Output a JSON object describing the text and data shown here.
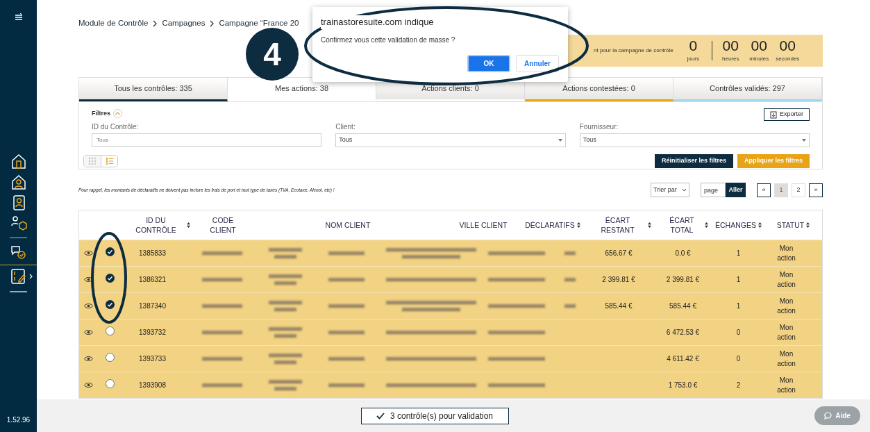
{
  "sidebar": {
    "version": "1.52.96"
  },
  "breadcrumb": [
    "Module de Contrôle",
    "Campagnes",
    "Campagne “France 20"
  ],
  "countdown": {
    "caption": "nt pour la campagne de contrôle",
    "units": [
      {
        "value": "0",
        "label": "jours"
      },
      {
        "value": "00",
        "label": "heures"
      },
      {
        "value": "00",
        "label": "minutes"
      },
      {
        "value": "00",
        "label": "secondes"
      }
    ]
  },
  "tabs": [
    {
      "label": "Tous les contrôles: 335",
      "selected": false,
      "color": "#0d2c40"
    },
    {
      "label": "Mes actions: 38",
      "selected": true
    },
    {
      "label": "Actions clients: 0",
      "selected": false
    },
    {
      "label": "Actions contestées: 0",
      "selected": false,
      "color": "#e8a317"
    },
    {
      "label": "Contrôles validés: 297",
      "selected": false,
      "color": "#9fd6f0"
    }
  ],
  "filters": {
    "title": "Filtres",
    "export": "Exporter",
    "fields": [
      {
        "kind": "text",
        "label": "ID du Contrôle:",
        "placeholder": "Tous"
      },
      {
        "kind": "select",
        "label": "Client:",
        "value": "Tous"
      },
      {
        "kind": "select",
        "label": "Fournisseur:",
        "value": "Tous"
      }
    ],
    "view_modes": [
      {
        "kind": "grid",
        "selected": false
      },
      {
        "kind": "list",
        "selected": true
      }
    ],
    "reset": "Réinitialiser les filtres",
    "apply": "Appliquer les filtres"
  },
  "note": "Pour rappel, les montants de déclaratifs ne doivent pas inclure les frais de port et tout type de taxes (TVA, Ecotaxe, Alcool, etc) !",
  "sort": {
    "label": "Trier par"
  },
  "goto": {
    "placeholder": "page",
    "button": "Aller"
  },
  "pagination": {
    "prev": "«",
    "pages": [
      {
        "label": "1",
        "selected": true
      },
      {
        "label": "2",
        "selected": false
      }
    ],
    "next": "»"
  },
  "table": {
    "columns": [
      {
        "label": "ID DU CONTRÔLE",
        "sortable": true
      },
      {
        "label": "CODE CLIENT",
        "sortable": false
      },
      {
        "label": "NOM CLIENT",
        "sortable": false
      },
      {
        "label": "VILLE CLIENT",
        "sortable": false
      },
      {
        "label": "DÉCLARATIFS",
        "sortable": true
      },
      {
        "label": "ÉCART RESTANT",
        "sortable": true
      },
      {
        "label": "ÉCART TOTAL",
        "sortable": true
      },
      {
        "label": "ÉCHANGES",
        "sortable": true
      },
      {
        "label": "STATUT",
        "sortable": true
      }
    ],
    "rows": [
      {
        "id": "1385833",
        "checked": true,
        "declaratifs_blurred": true,
        "nom_wraps": true,
        "ecart_restant": "656.67 €",
        "ecart_total": "0.0 €",
        "echanges": "1",
        "statut": "Mon action"
      },
      {
        "id": "1386321",
        "checked": true,
        "declaratifs_blurred": true,
        "nom_wraps": false,
        "ecart_restant": "2 399.81 €",
        "ecart_total": "2 399.81 €",
        "echanges": "1",
        "statut": "Mon action"
      },
      {
        "id": "1387340",
        "checked": true,
        "declaratifs_blurred": true,
        "nom_wraps": true,
        "ecart_restant": "585.44 €",
        "ecart_total": "585.44 €",
        "echanges": "1",
        "statut": "Mon action"
      },
      {
        "id": "1393732",
        "checked": false,
        "declaratifs_blurred": false,
        "nom_wraps": false,
        "ecart_total": "6 472.53 €",
        "echanges": "0",
        "statut": "Mon action"
      },
      {
        "id": "1393733",
        "checked": false,
        "declaratifs_blurred": false,
        "nom_wraps": false,
        "ecart_total": "4 611.42 €",
        "echanges": "0",
        "statut": "Mon action"
      },
      {
        "id": "1393908",
        "checked": false,
        "declaratifs_blurred": false,
        "nom_wraps": false,
        "ecart_total": "1 753.0 €",
        "echanges": "2",
        "statut": "Mon action"
      }
    ]
  },
  "validate_button": "3 contrôle(s) pour validation",
  "help_button": "Aide",
  "dialog": {
    "title": "trainastoresuite.com indique",
    "message": "Confirmez vous cette validation de masse ?",
    "ok": "OK",
    "cancel": "Annuler"
  },
  "annotation": {
    "step": "4"
  }
}
